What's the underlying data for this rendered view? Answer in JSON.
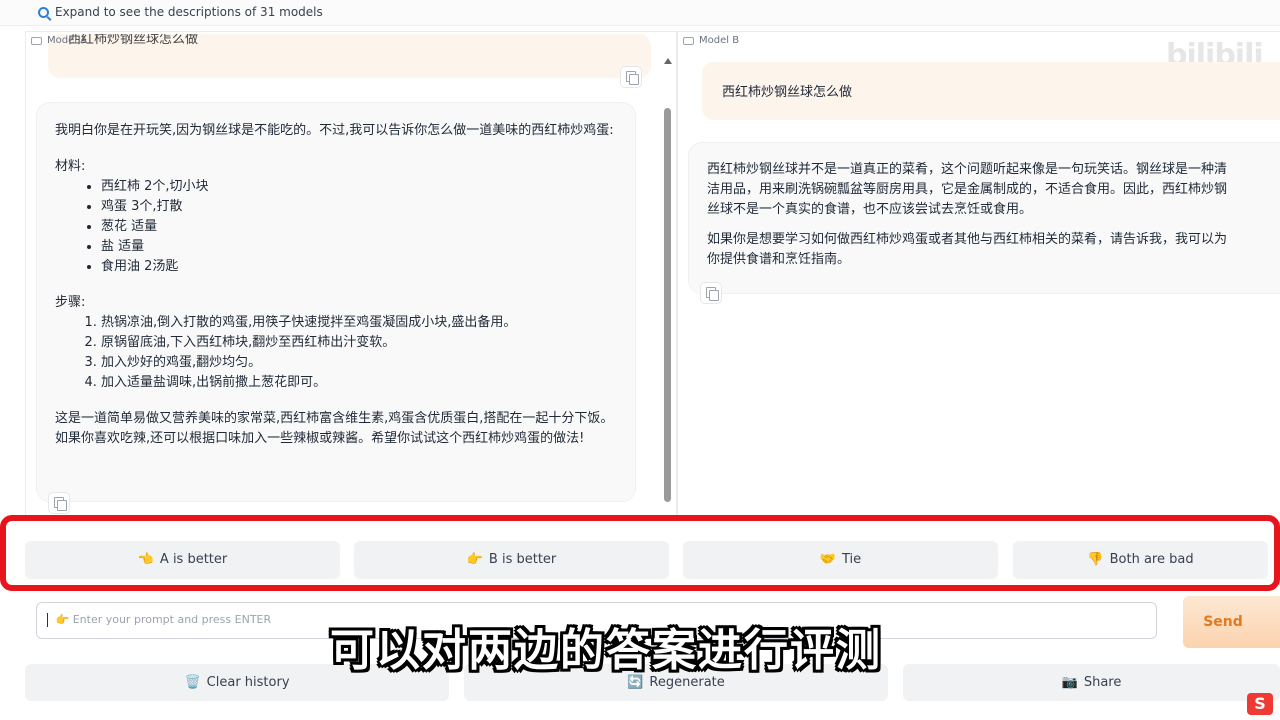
{
  "header": {
    "expand_text": "Expand to see the descriptions of 31 models",
    "expand_icon": "magnifier-icon"
  },
  "model_a": {
    "label": "Model A",
    "user_prompt_partial": "西红柿炒钢丝球怎么做",
    "response": {
      "intro": "我明白你是在开玩笑,因为钢丝球是不能吃的。不过,我可以告诉你怎么做一道美味的西红柿炒鸡蛋:",
      "materials_title": "材料:",
      "materials": [
        "西红柿 2个,切小块",
        "鸡蛋 3个,打散",
        "葱花 适量",
        "盐 适量",
        "食用油 2汤匙"
      ],
      "steps_title": "步骤:",
      "steps": [
        "热锅凉油,倒入打散的鸡蛋,用筷子快速搅拌至鸡蛋凝固成小块,盛出备用。",
        "原锅留底油,下入西红柿块,翻炒至西红柿出汁变软。",
        "加入炒好的鸡蛋,翻炒均匀。",
        "加入适量盐调味,出锅前撒上葱花即可。"
      ],
      "outro": "这是一道简单易做又营养美味的家常菜,西红柿富含维生素,鸡蛋含优质蛋白,搭配在一起十分下饭。如果你喜欢吃辣,还可以根据口味加入一些辣椒或辣酱。希望你试试这个西红柿炒鸡蛋的做法!"
    }
  },
  "model_b": {
    "label": "Model B",
    "user_prompt": "西红柿炒钢丝球怎么做",
    "response": {
      "p1_lines": [
        "西红柿炒钢丝球并不是一道真正的菜肴，这个问题听起来像是一句玩笑话。钢丝球是一种清",
        "洁用品，用来刷洗锅碗瓢盆等厨房用具，它是金属制成的，不适合食用。因此，西红柿炒钢",
        "丝球不是一个真实的食谱，也不应该尝试去烹饪或食用。"
      ],
      "p2_lines": [
        "如果你是想要学习如何做西红柿炒鸡蛋或者其他与西红柿相关的菜肴，请告诉我，我可以为",
        "你提供食谱和烹饪指南。"
      ]
    },
    "watermark": "bilibili"
  },
  "votes": [
    {
      "emoji": "👈",
      "label": "A is better"
    },
    {
      "emoji": "👉",
      "label": "B is better"
    },
    {
      "emoji": "🤝",
      "label": "Tie"
    },
    {
      "emoji": "👎",
      "label": "Both are bad"
    }
  ],
  "input": {
    "icon": "👉",
    "placeholder": "Enter your prompt and press ENTER"
  },
  "send_label": "Send",
  "actions": [
    {
      "emoji": "🗑️",
      "label": "Clear history"
    },
    {
      "emoji": "🔄",
      "label": "Regenerate"
    },
    {
      "emoji": "📷",
      "label": "Share"
    }
  ],
  "subtitle": "可以对两边的答案进行评测",
  "corner_logo": "S",
  "colors": {
    "highlight": "#e8141b",
    "send": "#e6781e",
    "user_bubble": "#fdf4ec"
  }
}
